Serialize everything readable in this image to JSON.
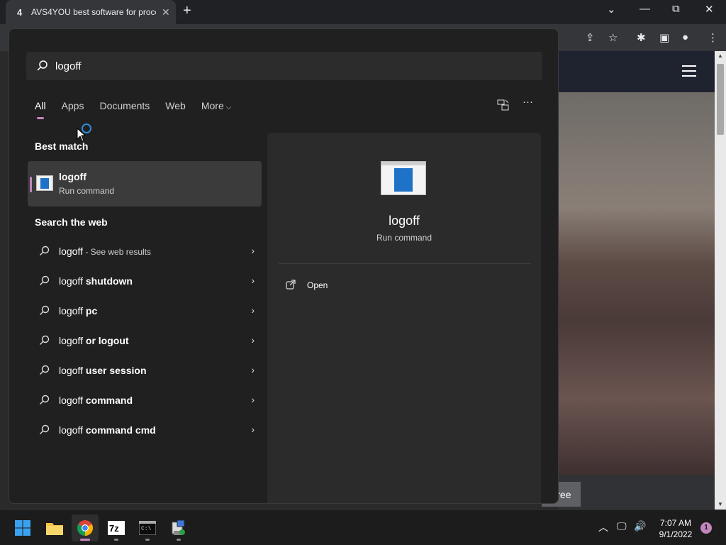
{
  "browser": {
    "tab_count": "4",
    "tab_title": "AVS4YOU best software for proce",
    "close_tab": "✕",
    "new_tab": "+",
    "win_dropdown": "⌄",
    "win_minimize": "—",
    "win_restore": "⧉",
    "win_close": "✕",
    "toolbar_icons": [
      "share-icon",
      "star-icon",
      "extensions-icon",
      "sidepanel-icon",
      "profile-icon",
      "menu-icon"
    ]
  },
  "page": {
    "agree_label": "gree"
  },
  "search": {
    "query": "logoff",
    "filters": [
      "All",
      "Apps",
      "Documents",
      "Web",
      "More"
    ],
    "more_chevron": "⌵",
    "more_options": "···"
  },
  "best_match": {
    "heading": "Best match",
    "name": "logoff",
    "type": "Run command"
  },
  "web": {
    "heading": "Search the web",
    "items": [
      {
        "prefix": "logoff",
        "bold": "",
        "hint": " - See web results"
      },
      {
        "prefix": "logoff ",
        "bold": "shutdown",
        "hint": ""
      },
      {
        "prefix": "logoff ",
        "bold": "pc",
        "hint": ""
      },
      {
        "prefix": "logoff ",
        "bold": "or logout",
        "hint": ""
      },
      {
        "prefix": "logoff ",
        "bold": "user session",
        "hint": ""
      },
      {
        "prefix": "logoff ",
        "bold": "command",
        "hint": ""
      },
      {
        "prefix": "logoff ",
        "bold": "command cmd",
        "hint": ""
      }
    ]
  },
  "detail": {
    "name": "logoff",
    "type": "Run command",
    "action_open": "Open"
  },
  "taskbar": {
    "time": "7:07 AM",
    "date": "9/1/2022",
    "notification_count": "1",
    "apps": [
      "windows-start-icon",
      "file-explorer-icon",
      "chrome-icon",
      "7zip-icon",
      "terminal-icon",
      "network-setup-icon"
    ]
  },
  "colors": {
    "accent": "#c586c0",
    "panel_bg": "#202020",
    "detail_bg": "#2b2b2b"
  }
}
